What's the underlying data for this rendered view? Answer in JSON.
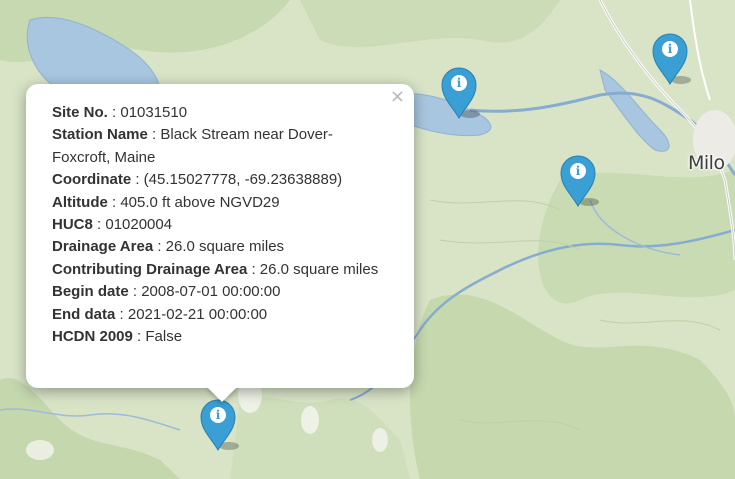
{
  "map": {
    "place_labels": [
      "Milo"
    ]
  },
  "markers": [
    {
      "icon": "info-icon",
      "glyph": "i",
      "color": "#3a9fd4"
    },
    {
      "icon": "info-icon",
      "glyph": "i",
      "color": "#3a9fd4"
    },
    {
      "icon": "info-icon",
      "glyph": "i",
      "color": "#3a9fd4"
    },
    {
      "icon": "info-icon",
      "glyph": "i",
      "color": "#3a9fd4"
    }
  ],
  "popup": {
    "close_label": "×",
    "fields": [
      {
        "label": "Site No.",
        "value": ": 01031510"
      },
      {
        "label": "Station Name",
        "value": ": Black Stream near Dover-Foxcroft, Maine"
      },
      {
        "label": "Coordinate",
        "value": ": (45.15027778, -69.23638889)"
      },
      {
        "label": "Altitude",
        "value": ": 405.0 ft above NGVD29"
      },
      {
        "label": "HUC8",
        "value": ": 01020004"
      },
      {
        "label": "Drainage Area",
        "value": ": 26.0 square miles"
      },
      {
        "label": "Contributing Drainage Area",
        "value": ": 26.0 square miles"
      },
      {
        "label": "Begin date",
        "value": ": 2008-07-01 00:00:00"
      },
      {
        "label": "End data",
        "value": ": 2021-02-21 00:00:00"
      },
      {
        "label": "HCDN 2009",
        "value": ": False"
      }
    ]
  },
  "colors": {
    "land": "#d9e4c7",
    "forest": "#c6d9b1",
    "water": "#a9c7e0",
    "marker": "#3a9fd4"
  }
}
